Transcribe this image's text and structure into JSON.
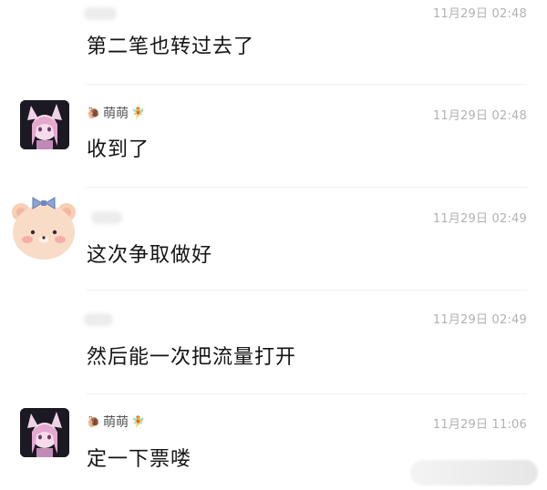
{
  "messages": [
    {
      "sender": "",
      "time": "11月29日 02:48",
      "text": "第二笔也转过去了"
    },
    {
      "sender": "萌萌",
      "time": "11月29日 02:48",
      "text": "收到了"
    },
    {
      "sender": "",
      "time": "11月29日 02:49",
      "text": "这次争取做好"
    },
    {
      "sender": "",
      "time": "11月29日 02:49",
      "text": "然后能一次把流量打开"
    },
    {
      "sender": "萌萌",
      "time": "11月29日 11:06",
      "text": "定一下票喽"
    }
  ],
  "icons": {
    "cat_avatar": "anime-cat-girl-avatar",
    "bear_avatar": "bear-with-bow-avatar",
    "name_prefix": "snail-emoji-icon",
    "name_suffix": "fairy-emoji-icon"
  },
  "colors": {
    "time": "#b2b2b2",
    "text": "#141414",
    "bear": "#f6cfb7",
    "bow": "#6e86b8"
  }
}
